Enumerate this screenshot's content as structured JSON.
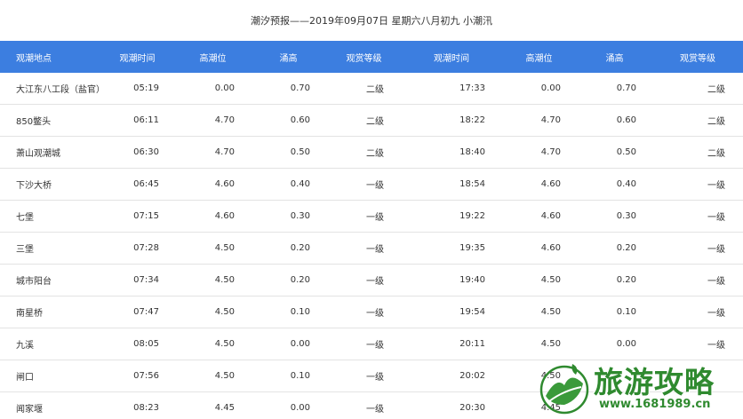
{
  "title": "潮汐预报——2019年09月07日 星期六八月初九 小潮汛",
  "headers": [
    "观潮地点",
    "观潮时间",
    "高潮位",
    "涌高",
    "观赏等级",
    "观潮时间",
    "高潮位",
    "涌高",
    "观赏等级"
  ],
  "rows": [
    [
      "大江东八工段（盐官）",
      "05:19",
      "0.00",
      "0.70",
      "二级",
      "17:33",
      "0.00",
      "0.70",
      "二级"
    ],
    [
      "850鳖头",
      "06:11",
      "4.70",
      "0.60",
      "二级",
      "18:22",
      "4.70",
      "0.60",
      "二级"
    ],
    [
      "萧山观潮城",
      "06:30",
      "4.70",
      "0.50",
      "二级",
      "18:40",
      "4.70",
      "0.50",
      "二级"
    ],
    [
      "下沙大桥",
      "06:45",
      "4.60",
      "0.40",
      "一级",
      "18:54",
      "4.60",
      "0.40",
      "一级"
    ],
    [
      "七堡",
      "07:15",
      "4.60",
      "0.30",
      "一级",
      "19:22",
      "4.60",
      "0.30",
      "一级"
    ],
    [
      "三堡",
      "07:28",
      "4.50",
      "0.20",
      "一级",
      "19:35",
      "4.60",
      "0.20",
      "一级"
    ],
    [
      "城市阳台",
      "07:34",
      "4.50",
      "0.20",
      "一级",
      "19:40",
      "4.50",
      "0.20",
      "一级"
    ],
    [
      "南星桥",
      "07:47",
      "4.50",
      "0.10",
      "一级",
      "19:54",
      "4.50",
      "0.10",
      "一级"
    ],
    [
      "九溪",
      "08:05",
      "4.50",
      "0.00",
      "一级",
      "20:11",
      "4.50",
      "0.00",
      "一级"
    ],
    [
      "闸口",
      "07:56",
      "4.50",
      "0.10",
      "一级",
      "20:02",
      "4.50",
      "",
      ""
    ],
    [
      "闻家堰",
      "08:23",
      "4.45",
      "0.00",
      "一级",
      "20:30",
      "4.45",
      "",
      ""
    ]
  ],
  "watermark": {
    "text": "旅游攻略",
    "url": "www.1681989.cn"
  },
  "colors": {
    "header_bg": "#3c7ee0",
    "header_text": "#ffffff",
    "watermark": "#2f8a2f"
  }
}
